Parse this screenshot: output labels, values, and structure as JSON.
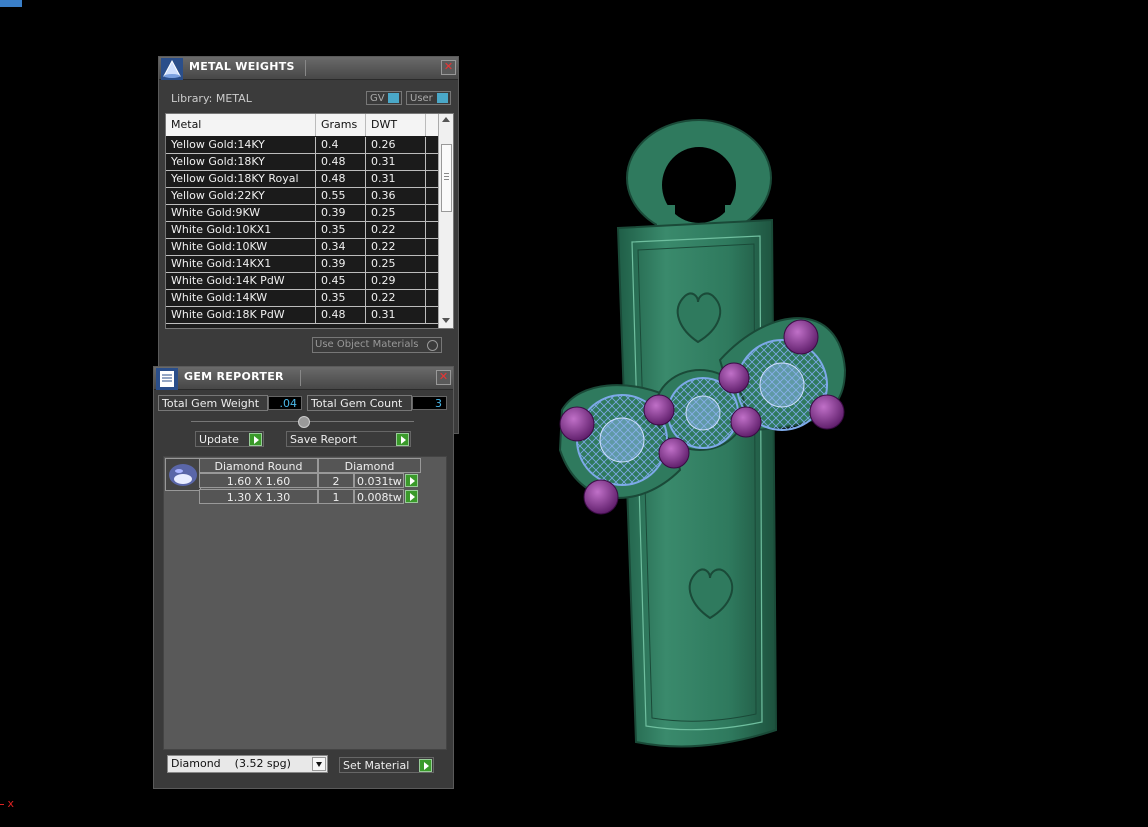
{
  "metal_weights": {
    "title": "METAL WEIGHTS",
    "library_label": "Library: METAL",
    "gv_label": "GV",
    "user_label": "User",
    "columns": [
      "Metal",
      "Grams",
      "DWT"
    ],
    "rows": [
      [
        "Yellow Gold:14KY",
        "0.4",
        "0.26"
      ],
      [
        "Yellow Gold:18KY",
        "0.48",
        "0.31"
      ],
      [
        "Yellow Gold:18KY Royal",
        "0.48",
        "0.31"
      ],
      [
        "Yellow Gold:22KY",
        "0.55",
        "0.36"
      ],
      [
        "White Gold:9KW",
        "0.39",
        "0.25"
      ],
      [
        "White Gold:10KX1",
        "0.35",
        "0.22"
      ],
      [
        "White Gold:10KW",
        "0.34",
        "0.22"
      ],
      [
        "White Gold:14KX1",
        "0.39",
        "0.25"
      ],
      [
        "White Gold:14K PdW",
        "0.45",
        "0.29"
      ],
      [
        "White Gold:14KW",
        "0.35",
        "0.22"
      ],
      [
        "White Gold:18K PdW",
        "0.48",
        "0.31"
      ]
    ],
    "use_object_materials": "Use Object Materials"
  },
  "gem_reporter": {
    "title": "GEM REPORTER",
    "total_gem_weight_label": "Total Gem Weight",
    "total_gem_weight": ".04",
    "total_gem_count_label": "Total Gem Count",
    "total_gem_count": "3",
    "update_label": "Update",
    "save_report_label": "Save Report",
    "table_header": [
      "Diamond Round",
      "Diamond"
    ],
    "gems": [
      {
        "size": "1.60 X 1.60",
        "count": "2",
        "weight": "0.031tw"
      },
      {
        "size": "1.30 X 1.30",
        "count": "1",
        "weight": "0.008tw"
      }
    ],
    "material_select": "Diamond    (3.52 spg)",
    "set_material_label": "Set Material"
  },
  "viewport": {
    "axis_label": "x"
  },
  "colors": {
    "metal_model": "#2f7a5e",
    "gem_outline": "#7da9e8",
    "prong": "#7a2d86",
    "accent_green": "#3a9a2a",
    "value_blue": "#4ab8e8"
  }
}
